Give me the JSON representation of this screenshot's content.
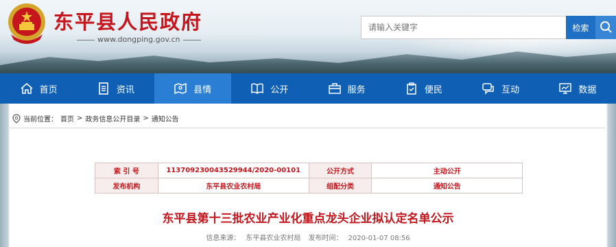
{
  "header": {
    "site_title": "东平县人民政府",
    "site_url": "www.dongping.gov.cn",
    "search": {
      "placeholder": "请输入关键字",
      "button_label": "检索"
    }
  },
  "nav": {
    "items": [
      {
        "label": "首页",
        "icon": "home-icon"
      },
      {
        "label": "资讯",
        "icon": "document-icon"
      },
      {
        "label": "县情",
        "icon": "map-icon",
        "active": true
      },
      {
        "label": "公开",
        "icon": "book-icon"
      },
      {
        "label": "服务",
        "icon": "briefcase-icon"
      },
      {
        "label": "便民",
        "icon": "clipboard-icon"
      },
      {
        "label": "互动",
        "icon": "chat-icon"
      },
      {
        "label": "数据",
        "icon": "monitor-icon"
      }
    ]
  },
  "breadcrumb": {
    "prefix": "当前位置：",
    "items": [
      "首页",
      "政务信息公开目录",
      "通知公告"
    ],
    "separator": ">"
  },
  "meta": {
    "index_label": "索 引 号",
    "index_value": "113709230043529944/2020-00101",
    "method_label": "公开方式",
    "method_value": "主动公开",
    "org_label": "发布机构",
    "org_value": "东平县农业农村局",
    "category_label": "组配分类",
    "category_value": "通知公告"
  },
  "article": {
    "title": "东平县第十三批农业产业化重点龙头企业拟认定名单公示",
    "source_label": "信息来源：",
    "source_value": "东平县农业农村局",
    "date_label": "发布时间：",
    "date_value": "2020-01-07 08:56"
  },
  "colors": {
    "brand_red": "#c4161c",
    "nav_blue": "#0f5fb4",
    "nav_active": "#2a7fd4",
    "search_button": "#1f6fc5"
  }
}
